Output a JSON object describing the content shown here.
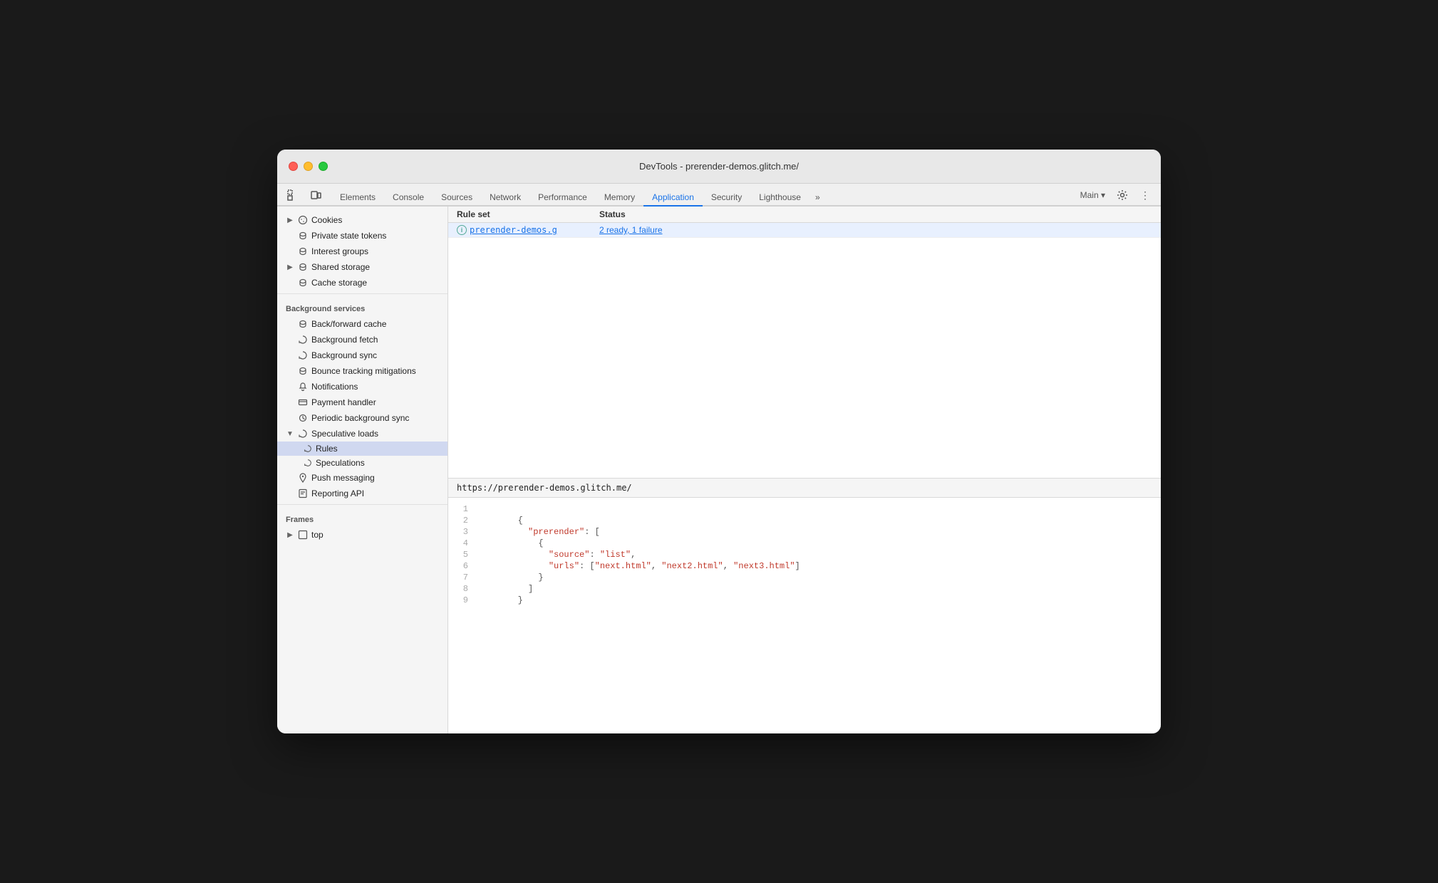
{
  "window": {
    "title": "DevTools - prerender-demos.glitch.me/"
  },
  "toolbar": {
    "icons": [
      "inspect",
      "device-toolbar"
    ]
  },
  "tabs": [
    {
      "id": "elements",
      "label": "Elements",
      "active": false
    },
    {
      "id": "console",
      "label": "Console",
      "active": false
    },
    {
      "id": "sources",
      "label": "Sources",
      "active": false
    },
    {
      "id": "network",
      "label": "Network",
      "active": false
    },
    {
      "id": "performance",
      "label": "Performance",
      "active": false
    },
    {
      "id": "memory",
      "label": "Memory",
      "active": false
    },
    {
      "id": "application",
      "label": "Application",
      "active": true
    },
    {
      "id": "security",
      "label": "Security",
      "active": false
    },
    {
      "id": "lighthouse",
      "label": "Lighthouse",
      "active": false
    }
  ],
  "sidebar": {
    "sections": [
      {
        "id": "storage",
        "items": [
          {
            "id": "cookies",
            "label": "Cookies",
            "icon": "expand-right",
            "hasArrow": true,
            "indent": 0
          },
          {
            "id": "private-state-tokens",
            "label": "Private state tokens",
            "icon": "db",
            "indent": 0
          },
          {
            "id": "interest-groups",
            "label": "Interest groups",
            "icon": "db",
            "indent": 0
          },
          {
            "id": "shared-storage",
            "label": "Shared storage",
            "icon": "expand-right",
            "hasArrow": true,
            "iconType": "db",
            "indent": 0
          },
          {
            "id": "cache-storage",
            "label": "Cache storage",
            "icon": "db",
            "indent": 0
          }
        ]
      },
      {
        "id": "background-services",
        "label": "Background services",
        "items": [
          {
            "id": "back-forward-cache",
            "label": "Back/forward cache",
            "icon": "db",
            "indent": 0
          },
          {
            "id": "background-fetch",
            "label": "Background fetch",
            "icon": "sync",
            "indent": 0
          },
          {
            "id": "background-sync",
            "label": "Background sync",
            "icon": "sync",
            "indent": 0
          },
          {
            "id": "bounce-tracking",
            "label": "Bounce tracking mitigations",
            "icon": "db",
            "indent": 0
          },
          {
            "id": "notifications",
            "label": "Notifications",
            "icon": "bell",
            "indent": 0
          },
          {
            "id": "payment-handler",
            "label": "Payment handler",
            "icon": "card",
            "indent": 0
          },
          {
            "id": "periodic-background-sync",
            "label": "Periodic background sync",
            "icon": "clock",
            "indent": 0
          },
          {
            "id": "speculative-loads",
            "label": "Speculative loads",
            "icon": "sync",
            "hasArrow": true,
            "expanded": true,
            "indent": 0
          },
          {
            "id": "rules",
            "label": "Rules",
            "icon": "sync",
            "indent": 1,
            "active": true
          },
          {
            "id": "speculations",
            "label": "Speculations",
            "icon": "sync",
            "indent": 1
          },
          {
            "id": "push-messaging",
            "label": "Push messaging",
            "icon": "cloud",
            "indent": 0
          },
          {
            "id": "reporting-api",
            "label": "Reporting API",
            "icon": "file",
            "indent": 0
          }
        ]
      },
      {
        "id": "frames",
        "label": "Frames",
        "items": [
          {
            "id": "top",
            "label": "top",
            "icon": "expand-right",
            "hasArrow": true,
            "indent": 0
          }
        ]
      }
    ]
  },
  "table": {
    "headers": [
      "Rule set",
      "Status"
    ],
    "rows": [
      {
        "ruleset": "prerender-demos.g",
        "status": "2 ready, 1 failure",
        "hasInfoIcon": true
      }
    ]
  },
  "detail": {
    "url": "https://prerender-demos.glitch.me/",
    "code_lines": [
      {
        "num": "1",
        "content": ""
      },
      {
        "num": "2",
        "content": "        {"
      },
      {
        "num": "3",
        "content": "          \"prerender\": ["
      },
      {
        "num": "4",
        "content": "            {"
      },
      {
        "num": "5",
        "content": "              \"source\": \"list\","
      },
      {
        "num": "6",
        "content": "              \"urls\": [\"next.html\", \"next2.html\", \"next3.html\"]"
      },
      {
        "num": "7",
        "content": "            }"
      },
      {
        "num": "8",
        "content": "          ]"
      },
      {
        "num": "9",
        "content": "        }"
      }
    ]
  }
}
